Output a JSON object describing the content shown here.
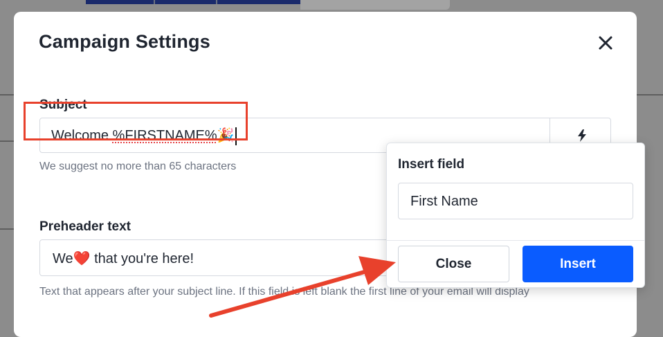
{
  "modal": {
    "title": "Campaign Settings"
  },
  "subject": {
    "label": "Subject",
    "value_prefix": "Welcome ",
    "value_merge": "%FIRSTNAME%",
    "value_emoji": "🎉",
    "helper": "We suggest no more than 65 characters"
  },
  "preheader": {
    "label": "Preheader text",
    "value_a": "We",
    "value_emoji": "❤️",
    "value_b": " that you're here!",
    "helper": "Text that appears after your subject line. If this field is left blank the first line of your email will display"
  },
  "insert_field": {
    "title": "Insert field",
    "selected": "First Name",
    "close_label": "Close",
    "insert_label": "Insert"
  },
  "icons": {
    "close": "close-icon",
    "bolt": "lightning-icon"
  },
  "colors": {
    "primary": "#0a5cff",
    "annotation": "#e8412c"
  }
}
